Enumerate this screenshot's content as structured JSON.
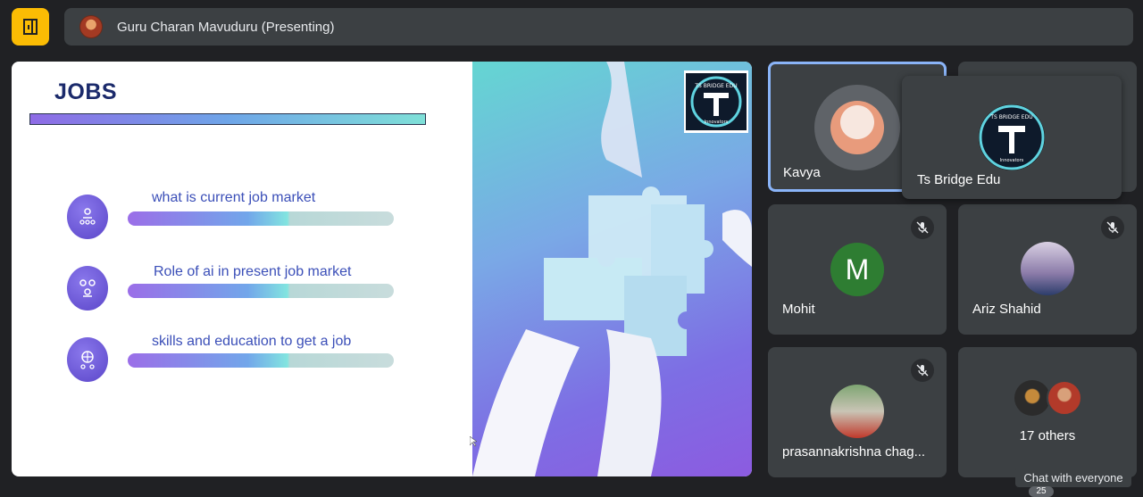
{
  "header": {
    "presenter": "Guru Charan Mavuduru (Presenting)"
  },
  "slide": {
    "title": "JOBS",
    "items": [
      {
        "text": "what is current job market"
      },
      {
        "text": "Role of ai in present job market"
      },
      {
        "text": "skills and education to get a job"
      }
    ],
    "logo_text": "TS BRIDGE EDU",
    "logo_sub": "Innovators"
  },
  "participants": [
    {
      "name": "Kavya"
    },
    {
      "name": "Mohit",
      "initial": "M"
    },
    {
      "name": "Ariz Shahid"
    },
    {
      "name": "prasannakrishna chag..."
    },
    {
      "name": "17 others"
    }
  ],
  "hover_card": {
    "name": "Ts Bridge Edu"
  },
  "chat": {
    "label": "Chat with everyone",
    "count": "25"
  },
  "colors": {
    "accent_yellow": "#fbbc04",
    "tile_bg": "#3c4043",
    "active_border": "#8ab4f8",
    "mohit_avatar": "#2e7d32"
  }
}
